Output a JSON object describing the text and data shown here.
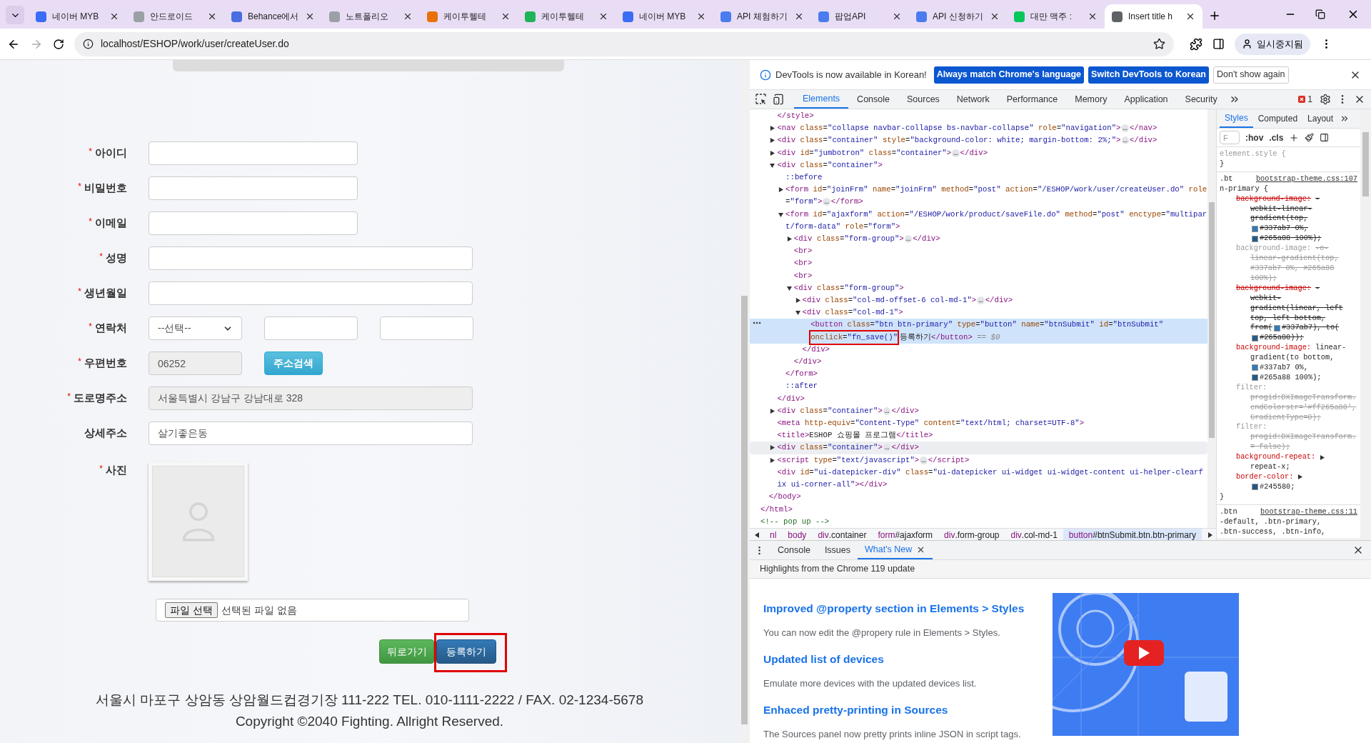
{
  "browser": {
    "tabs": [
      {
        "title": "네이버 MYB",
        "selected": false,
        "color": "#3b6cf6"
      },
      {
        "title": "안드로이드",
        "selected": false,
        "color": "#9aa0a6"
      },
      {
        "title": "Behance에서",
        "selected": false,
        "color": "#4a6ee0"
      },
      {
        "title": "노트폴리오",
        "selected": false,
        "color": "#9aa0a6"
      },
      {
        "title": "케이투헬테",
        "selected": false,
        "color": "#e8710a"
      },
      {
        "title": "케이투헬테",
        "selected": false,
        "color": "#1fb35a"
      },
      {
        "title": "네이버 MYB",
        "selected": false,
        "color": "#3b6cf6"
      },
      {
        "title": "API 체험하기",
        "selected": false,
        "color": "#4a7cf0"
      },
      {
        "title": "팝업API",
        "selected": false,
        "color": "#4a7cf0"
      },
      {
        "title": "API 신청하기",
        "selected": false,
        "color": "#4a7cf0"
      },
      {
        "title": "대만 맥주 :",
        "selected": false,
        "color": "#03c75a"
      },
      {
        "title": "Insert title h",
        "selected": true,
        "color": "#5f6368"
      }
    ],
    "address": "localhost/ESHOP/work/user/createUser.do",
    "profile": "일시중지됨"
  },
  "page": {
    "required_mark": "*",
    "fields": [
      {
        "kind": "input",
        "label": "아이디",
        "required": true,
        "readonly": false
      },
      {
        "kind": "input",
        "label": "비밀번호",
        "required": true,
        "readonly": false
      },
      {
        "kind": "input",
        "label": "이메일",
        "required": true,
        "readonly": false
      },
      {
        "kind": "wide_input",
        "label": "성명",
        "required": true,
        "readonly": false
      },
      {
        "kind": "wide_input",
        "label": "생년월일",
        "required": true,
        "readonly": false
      },
      {
        "kind": "phone",
        "label": "연락처",
        "required": true,
        "select": "--선택--"
      },
      {
        "kind": "zip",
        "label": "우편번호",
        "required": true,
        "value": "06252",
        "readonly": true,
        "button": "주소검색"
      },
      {
        "kind": "wide_input",
        "label": "도로명주소",
        "required": true,
        "value": "서울특별시 강남구 강남대로 328",
        "readonly": true
      },
      {
        "kind": "wide_input",
        "label": "상세주소",
        "required": false,
        "value": "살기좋은동",
        "readonly": false
      },
      {
        "label": "사진",
        "required": true
      }
    ],
    "file": {
      "button": "파일 선택",
      "status": "선택된 파일 없음"
    },
    "buttons": [
      {
        "label": "뒤로가기",
        "kind": "success",
        "annotated": false
      },
      {
        "label": "등록하기",
        "kind": "primary",
        "annotated": true
      }
    ],
    "footer": [
      "서울시 마포구 상암동 상암월드컵경기장 111-222 TEL. 010-1111-2222 / FAX. 02-1234-5678",
      "Copyright ©2040 Fighting. Allright Reserved."
    ]
  },
  "devtools": {
    "infobar": {
      "message": "DevTools is now available in Korean!",
      "buttons": [
        {
          "label": "Always match Chrome's language",
          "kind": "primary"
        },
        {
          "label": "Switch DevTools to Korean",
          "kind": "primary"
        },
        {
          "label": "Don't show again",
          "kind": "secondary"
        }
      ]
    },
    "panels": [
      {
        "label": "Elements",
        "selected": true
      },
      {
        "label": "Console",
        "selected": false
      },
      {
        "label": "Sources",
        "selected": false
      },
      {
        "label": "Network",
        "selected": false
      },
      {
        "label": "Performance",
        "selected": false
      },
      {
        "label": "Memory",
        "selected": false
      },
      {
        "label": "Application",
        "selected": false
      },
      {
        "label": "Security",
        "selected": false
      }
    ],
    "errors": "1",
    "tree": [
      {
        "close": "</html>",
        "children": [
          {
            "close": "</body>",
            "children": [
              {
                "line": "</style>",
                "selected": false,
                "hovered": false
              },
              {
                "line": "<nav class=\"collapse navbar-collapse bs-navbar-collapse\" role=\"navigation\">…</nav>",
                "expanded": false,
                "selected": false,
                "hovered": false
              },
              {
                "line": "<div class=\"container\" style=\"background-color: white; margin-bottom: 2%;\">…</div>",
                "expanded": false,
                "selected": false,
                "hovered": false
              },
              {
                "line": "<div id=\"jumbotron\" class=\"container\">…</div>",
                "expanded": false,
                "selected": false,
                "hovered": false
              },
              {
                "line": "<div class=\"container\">",
                "expanded": true,
                "selected": false,
                "hovered": false,
                "close": "</div>",
                "children": [
                  {
                    "line": "::before",
                    "selected": false,
                    "hovered": false
                  },
                  {
                    "line": "<form id=\"joinFrm\" name=\"joinFrm\" method=\"post\" action=\"/ESHOP/work/user/createUser.do\" role=\"form\">…</form>",
                    "expanded": false,
                    "selected": false,
                    "hovered": false
                  },
                  {
                    "line": "<form id=\"ajaxform\" action=\"/ESHOP/work/product/saveFile.do\" method=\"post\" enctype=\"multipart/form-data\" role=\"form\">",
                    "expanded": true,
                    "selected": false,
                    "hovered": false,
                    "close": "</form>",
                    "children": [
                      {
                        "line": "<div class=\"form-group\">…</div>",
                        "expanded": false,
                        "selected": false,
                        "hovered": false
                      },
                      {
                        "line": "<br>",
                        "selected": false,
                        "hovered": false
                      },
                      {
                        "line": "<br>",
                        "selected": false,
                        "hovered": false
                      },
                      {
                        "line": "<br>",
                        "selected": false,
                        "hovered": false
                      },
                      {
                        "line": "<div class=\"form-group\">",
                        "expanded": true,
                        "selected": false,
                        "hovered": false,
                        "close": "</div>",
                        "children": [
                          {
                            "line": "<div class=\"col-md-offset-6 col-md-1\">…</div>",
                            "expanded": false,
                            "selected": false,
                            "hovered": false
                          },
                          {
                            "line": "<div class=\"col-md-1\">",
                            "expanded": true,
                            "selected": false,
                            "hovered": false,
                            "close": "</div>",
                            "children": [
                              {
                                "line": "<button class=\"btn btn-primary\" type=\"button\" name=\"btnSubmit\" id=\"btnSubmit\"",
                                "marked": "onclick=\"fn_save()\"",
                                "after": "등록하기</button>",
                                "suffix": "== $0",
                                "selected": true,
                                "hovered": false
                              }
                            ]
                          }
                        ]
                      }
                    ]
                  },
                  {
                    "line": "::after",
                    "selected": false,
                    "hovered": false
                  }
                ]
              },
              {
                "line": "<div class=\"container\">…</div>",
                "expanded": false,
                "selected": false,
                "hovered": false
              },
              {
                "line": "<meta http-equiv=\"Content-Type\" content=\"text/html; charset=UTF-8\">",
                "selected": false,
                "hovered": false
              },
              {
                "line": "<title>ESHOP 쇼핑몰 프로그램</title>",
                "selected": false,
                "hovered": false
              },
              {
                "line": "<div class=\"container\">…</div>",
                "expanded": false,
                "selected": false,
                "hovered": true
              },
              {
                "line": "<script type=\"text/javascript\">…</script>",
                "expanded": false,
                "selected": false,
                "hovered": false
              },
              {
                "line": "<div id=\"ui-datepicker-div\" class=\"ui-datepicker ui-widget ui-widget-content ui-helper-clearfix ui-corner-all\"></div>",
                "selected": false,
                "hovered": false
              }
            ]
          }
        ]
      },
      {
        "line": "<!-- pop up -->",
        "selected": false,
        "hovered": false
      }
    ],
    "breadcrumbs": [
      {
        "label": "nl",
        "selected": false
      },
      {
        "label": "body",
        "selected": false
      },
      {
        "label": "div.container",
        "selected": false
      },
      {
        "label": "form#ajaxform",
        "selected": false
      },
      {
        "label": "div.form-group",
        "selected": false
      },
      {
        "label": "div.col-md-1",
        "selected": false
      },
      {
        "label": "button#btnSubmit.btn.btn-primary",
        "selected": true
      }
    ],
    "styles": {
      "tabs": [
        {
          "label": "Styles",
          "selected": true
        },
        {
          "label": "Computed",
          "selected": false
        },
        {
          "label": "Layout",
          "selected": false
        }
      ],
      "filter_placeholder": "F",
      "toggles": [
        ":hov",
        ".cls"
      ],
      "rules": [
        {
          "kind": "inline",
          "selector": "element.style {",
          "close": "}"
        },
        {
          "kind": "matched",
          "selector": ".bt",
          "source": "bootstrap-theme.css:107",
          "selector_cont": [
            "n-primary {"
          ],
          "close": "}",
          "declarations": [
            {
              "name": "background-image:",
              "overridden": true,
              "invalid": false,
              "value_start": "-",
              "value_lines": [
                "webkit-linear-",
                "gradient(top,",
                "#337ab7 0%,",
                "#265a88 100%);"
              ]
            },
            {
              "name": "background-image:",
              "overridden": false,
              "invalid": true,
              "value_start": "-o-",
              "value_lines": [
                "linear-gradient(top,",
                "#337ab7 0%, #265a88",
                "100%);"
              ]
            },
            {
              "name": "background-image:",
              "overridden": true,
              "invalid": false,
              "value_start": "-",
              "value_lines": [
                "webkit-",
                "gradient(linear, left",
                "top, left bottom,",
                [
                  "from(",
                  "#337ab7), to("
                ],
                "#265a88));"
              ]
            },
            {
              "name": "background-image:",
              "overridden": false,
              "invalid": false,
              "value_start": "linear-",
              "value_lines": [
                "gradient(to bottom,",
                "#337ab7 0%,",
                "#265a88 100%);"
              ]
            },
            {
              "name": "filter:",
              "overridden": false,
              "invalid": true,
              "value_lines": [
                "progid:DXImageTransform.",
                "endColorstr='#ff265a88',",
                "GradientType=0);"
              ]
            },
            {
              "name": "filter:",
              "overridden": false,
              "invalid": true,
              "value_lines": [
                "progid:DXImageTransform.",
                "= false);"
              ]
            },
            {
              "name": "background-repeat:",
              "overridden": false,
              "invalid": false,
              "expandable": true,
              "value_lines": [
                "repeat-x;"
              ]
            },
            {
              "name": "border-color:",
              "overridden": false,
              "invalid": false,
              "expandable": true,
              "value_lines": [
                "#245580;"
              ]
            }
          ]
        },
        {
          "kind": "matched",
          "selector": ".btn",
          "source": "bootstrap-theme.css:11",
          "selector_cont": [
            "-default, .btn-primary,",
            ".btn-success, .btn-info,"
          ]
        }
      ]
    },
    "drawer": {
      "tabs": [
        {
          "label": "Console",
          "selected": false,
          "closable": false
        },
        {
          "label": "Issues",
          "selected": false,
          "closable": false
        },
        {
          "label": "What's New",
          "selected": true,
          "closable": true
        }
      ],
      "header": "Highlights from the Chrome 119 update",
      "items": [
        {
          "title": "Improved @property section in Elements > Styles",
          "text": "You can now edit the @propery rule in Elements > Styles."
        },
        {
          "title": "Updated list of devices",
          "text": "Emulate more devices with the updated devices list."
        },
        {
          "title": "Enhaced pretty-printing in Sources",
          "text": "The Sources panel now pretty prints inline JSON in script tags."
        }
      ]
    }
  }
}
